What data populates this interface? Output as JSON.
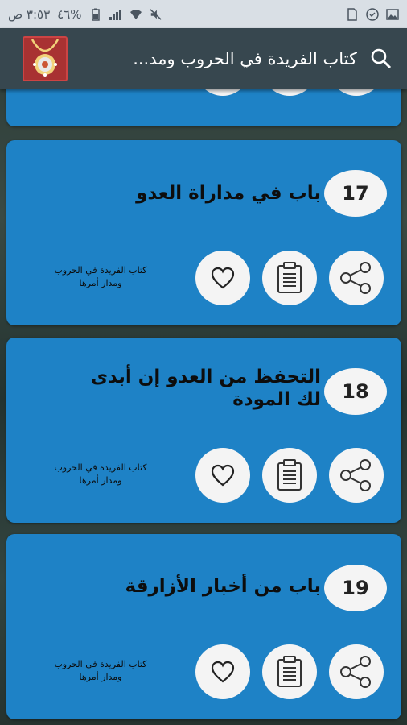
{
  "status_bar": {
    "time": "٣:٥٣ ص",
    "battery": "%٤٦",
    "icons": [
      "battery-icon",
      "signal-icon",
      "wifi-icon",
      "mute-icon",
      "sim-icon",
      "shield-icon",
      "image-icon"
    ]
  },
  "app_bar": {
    "title": "كتاب الفريدة في الحروب ومد...",
    "logo_icon": "necklace-logo",
    "search_icon": "search-icon"
  },
  "colors": {
    "card": "#1e82c6",
    "app_bar": "#37474f",
    "status_bar": "#d9dfe5"
  },
  "cards": [
    {
      "number": "17",
      "title": "باب في مداراة العدو",
      "book_label": "كتاب الفريدة في الحروب ومدار أمرها"
    },
    {
      "number": "18",
      "title": "التحفظ من العدو إن أبدى لك المودة",
      "book_label": "كتاب الفريدة في الحروب ومدار أمرها"
    },
    {
      "number": "19",
      "title": "باب من أخبار الأزارقة",
      "book_label": "كتاب الفريدة في الحروب ومدار أمرها"
    }
  ]
}
